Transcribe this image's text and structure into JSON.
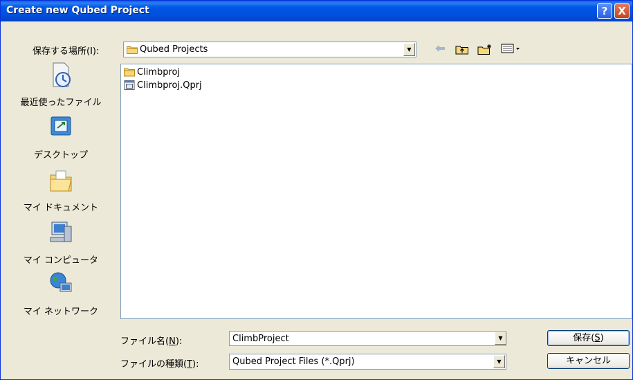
{
  "window": {
    "title": "Create new Qubed Project"
  },
  "titlebar": {
    "help_label": "?",
    "close_label": "X"
  },
  "location": {
    "label": "保存する場所(I):",
    "value": "Qubed Projects"
  },
  "toolbar": {
    "back_icon": "back-arrow-icon",
    "up_icon": "up-folder-icon",
    "new_folder_icon": "new-folder-icon",
    "view_menu_icon": "view-menu-icon"
  },
  "places": [
    {
      "label": "最近使ったファイル",
      "icon": "recent-files-icon"
    },
    {
      "label": "デスクトップ",
      "icon": "desktop-icon"
    },
    {
      "label": "マイ ドキュメント",
      "icon": "my-documents-icon"
    },
    {
      "label": "マイ コンピュータ",
      "icon": "my-computer-icon"
    },
    {
      "label": "マイ ネットワーク",
      "icon": "my-network-icon"
    }
  ],
  "files": [
    {
      "name": "Climbproj",
      "icon": "folder-icon"
    },
    {
      "name": "Climbproj.Qprj",
      "icon": "qprj-file-icon"
    }
  ],
  "filename": {
    "label": "ファイル名(N):",
    "value": "ClimbProject"
  },
  "filetype": {
    "label": "ファイルの種類(T):",
    "value": "Qubed Project Files (*.Qprj)"
  },
  "buttons": {
    "save": "保存(S)",
    "cancel": "キャンセル"
  },
  "colors": {
    "titlebar": "#0054e3",
    "dialog_bg": "#ece9d8",
    "border": "#7f9db9"
  }
}
